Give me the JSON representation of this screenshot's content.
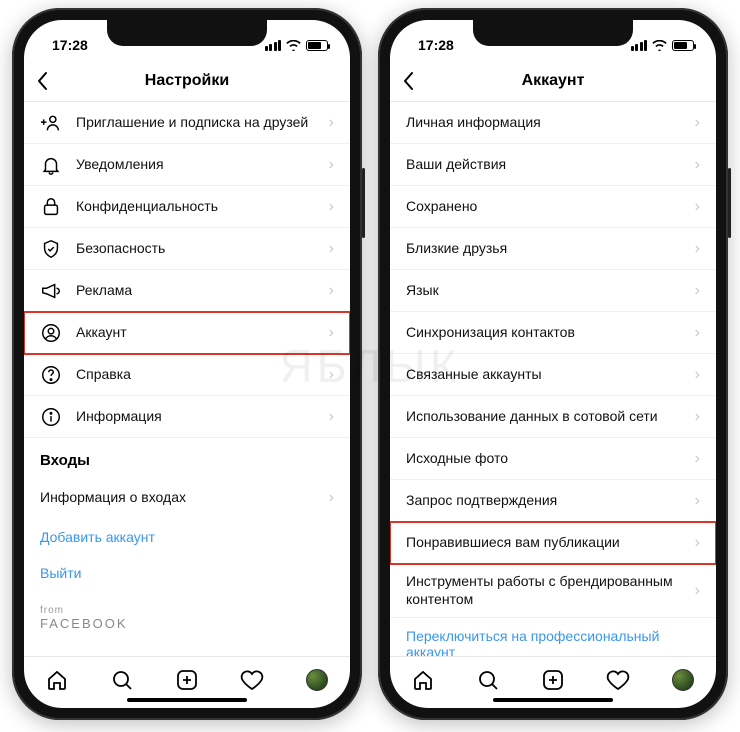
{
  "status": {
    "time": "17:28"
  },
  "left": {
    "title": "Настройки",
    "items": [
      {
        "icon": "add-user-icon",
        "label": "Приглашение и подписка на друзей"
      },
      {
        "icon": "bell-icon",
        "label": "Уведомления"
      },
      {
        "icon": "lock-icon",
        "label": "Конфиденциальность"
      },
      {
        "icon": "shield-icon",
        "label": "Безопасность"
      },
      {
        "icon": "megaphone-icon",
        "label": "Реклама"
      },
      {
        "icon": "person-circle-icon",
        "label": "Аккаунт",
        "highlighted": true
      },
      {
        "icon": "help-icon",
        "label": "Справка"
      },
      {
        "icon": "info-icon",
        "label": "Информация"
      }
    ],
    "section": "Входы",
    "login_info": "Информация о входах",
    "add_account": "Добавить аккаунт",
    "logout": "Выйти",
    "from": "from",
    "brand": "FACEBOOK"
  },
  "right": {
    "title": "Аккаунт",
    "items": [
      {
        "label": "Личная информация"
      },
      {
        "label": "Ваши действия"
      },
      {
        "label": "Сохранено"
      },
      {
        "label": "Близкие друзья"
      },
      {
        "label": "Язык"
      },
      {
        "label": "Синхронизация контактов"
      },
      {
        "label": "Связанные аккаунты"
      },
      {
        "label": "Использование данных в сотовой сети"
      },
      {
        "label": "Исходные фото"
      },
      {
        "label": "Запрос подтверждения"
      },
      {
        "label": "Понравившиеся вам публикации",
        "highlighted": true
      },
      {
        "label": "Инструменты работы с брендированным контентом",
        "tall": true
      }
    ],
    "switch": "Переключиться на профессиональный аккаунт"
  },
  "watermark": "ЯБЛЫК"
}
